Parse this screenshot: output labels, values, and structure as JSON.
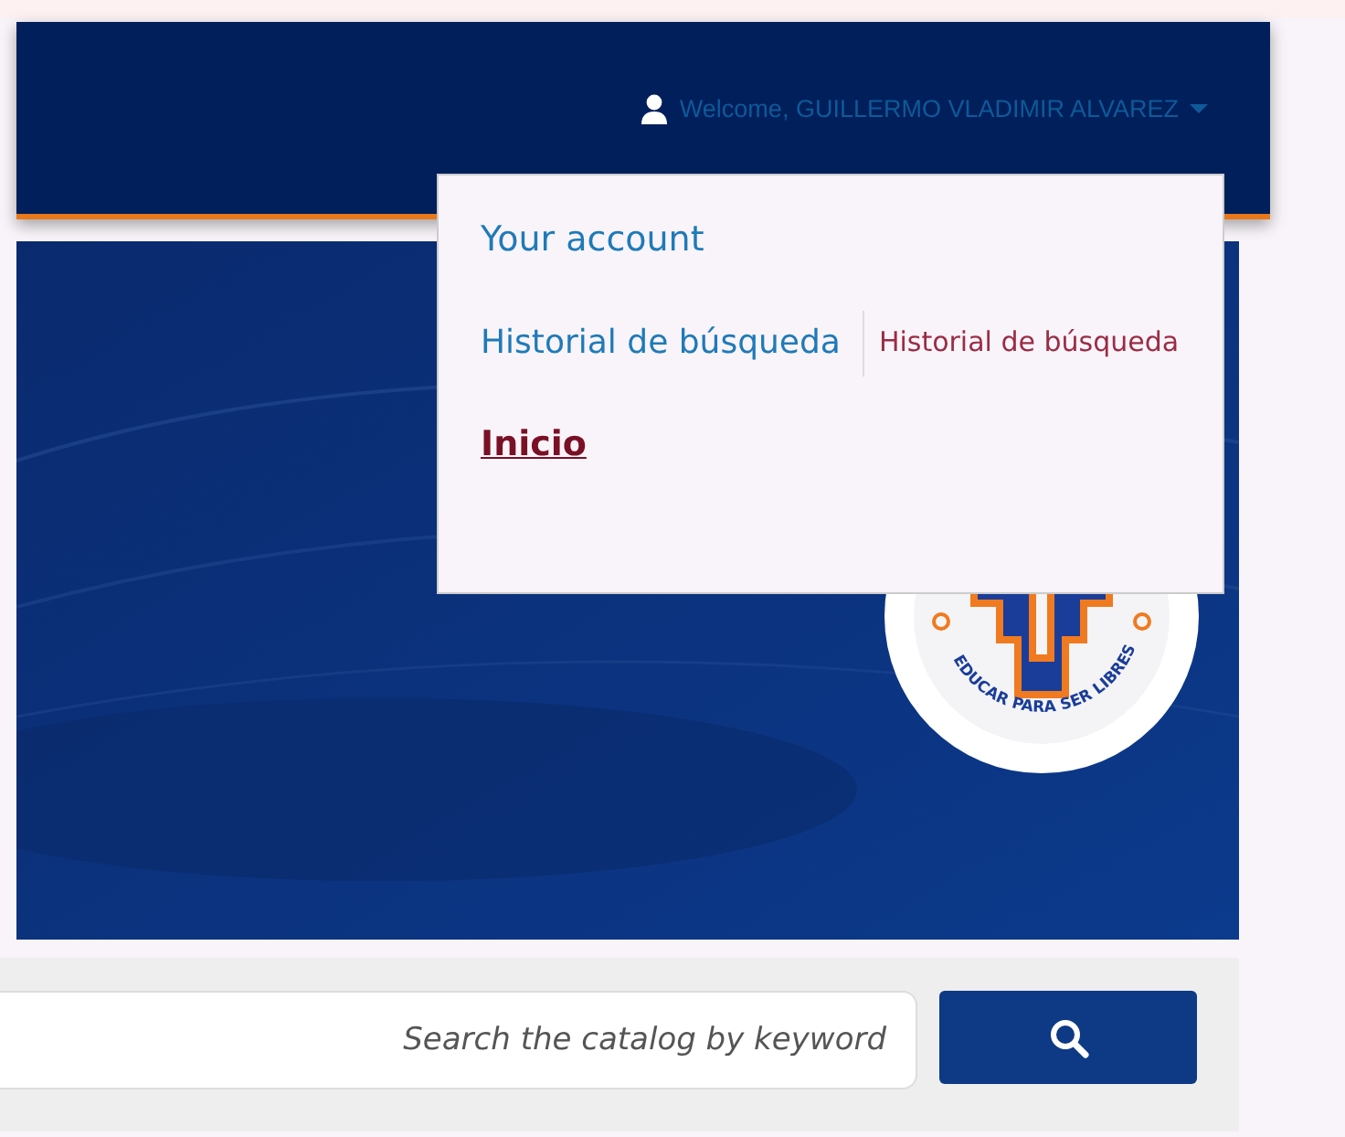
{
  "header": {
    "user_menu": {
      "label": "Welcome, GUILLERMO VLADIMIR ALVAREZ",
      "expanded": true
    }
  },
  "account_menu": {
    "heading": "Your account",
    "items": [
      {
        "kind": "pair",
        "label": "Historial de búsqueda",
        "note": "Historial de búsqueda"
      },
      {
        "kind": "bold_link",
        "label": "Inicio"
      }
    ]
  },
  "banner": {
    "logo_motto": "EDUCAR PARA SER LIBRES"
  },
  "search": {
    "placeholder": "Search the catalog by keyword"
  }
}
